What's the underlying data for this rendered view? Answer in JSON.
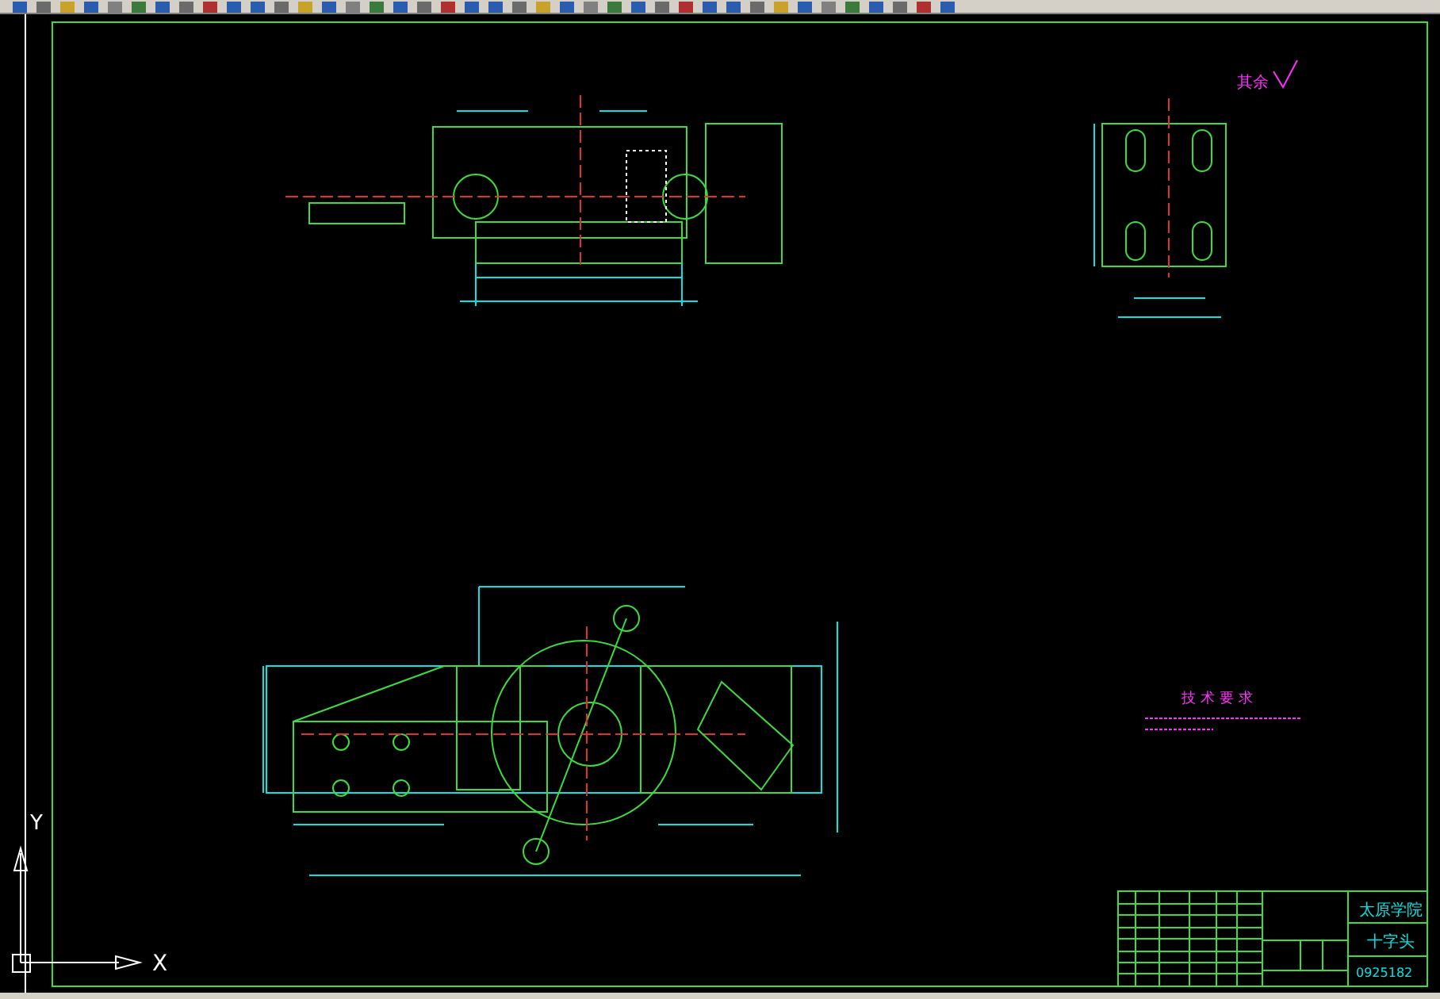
{
  "canvas": {
    "ucs_y": "Y",
    "ucs_x": "X",
    "roughness_note": "其余",
    "requirements_title": "技术要求"
  },
  "title_block": {
    "school": "太原学院",
    "part_name": "十字头",
    "drawing_no": "0925182"
  }
}
